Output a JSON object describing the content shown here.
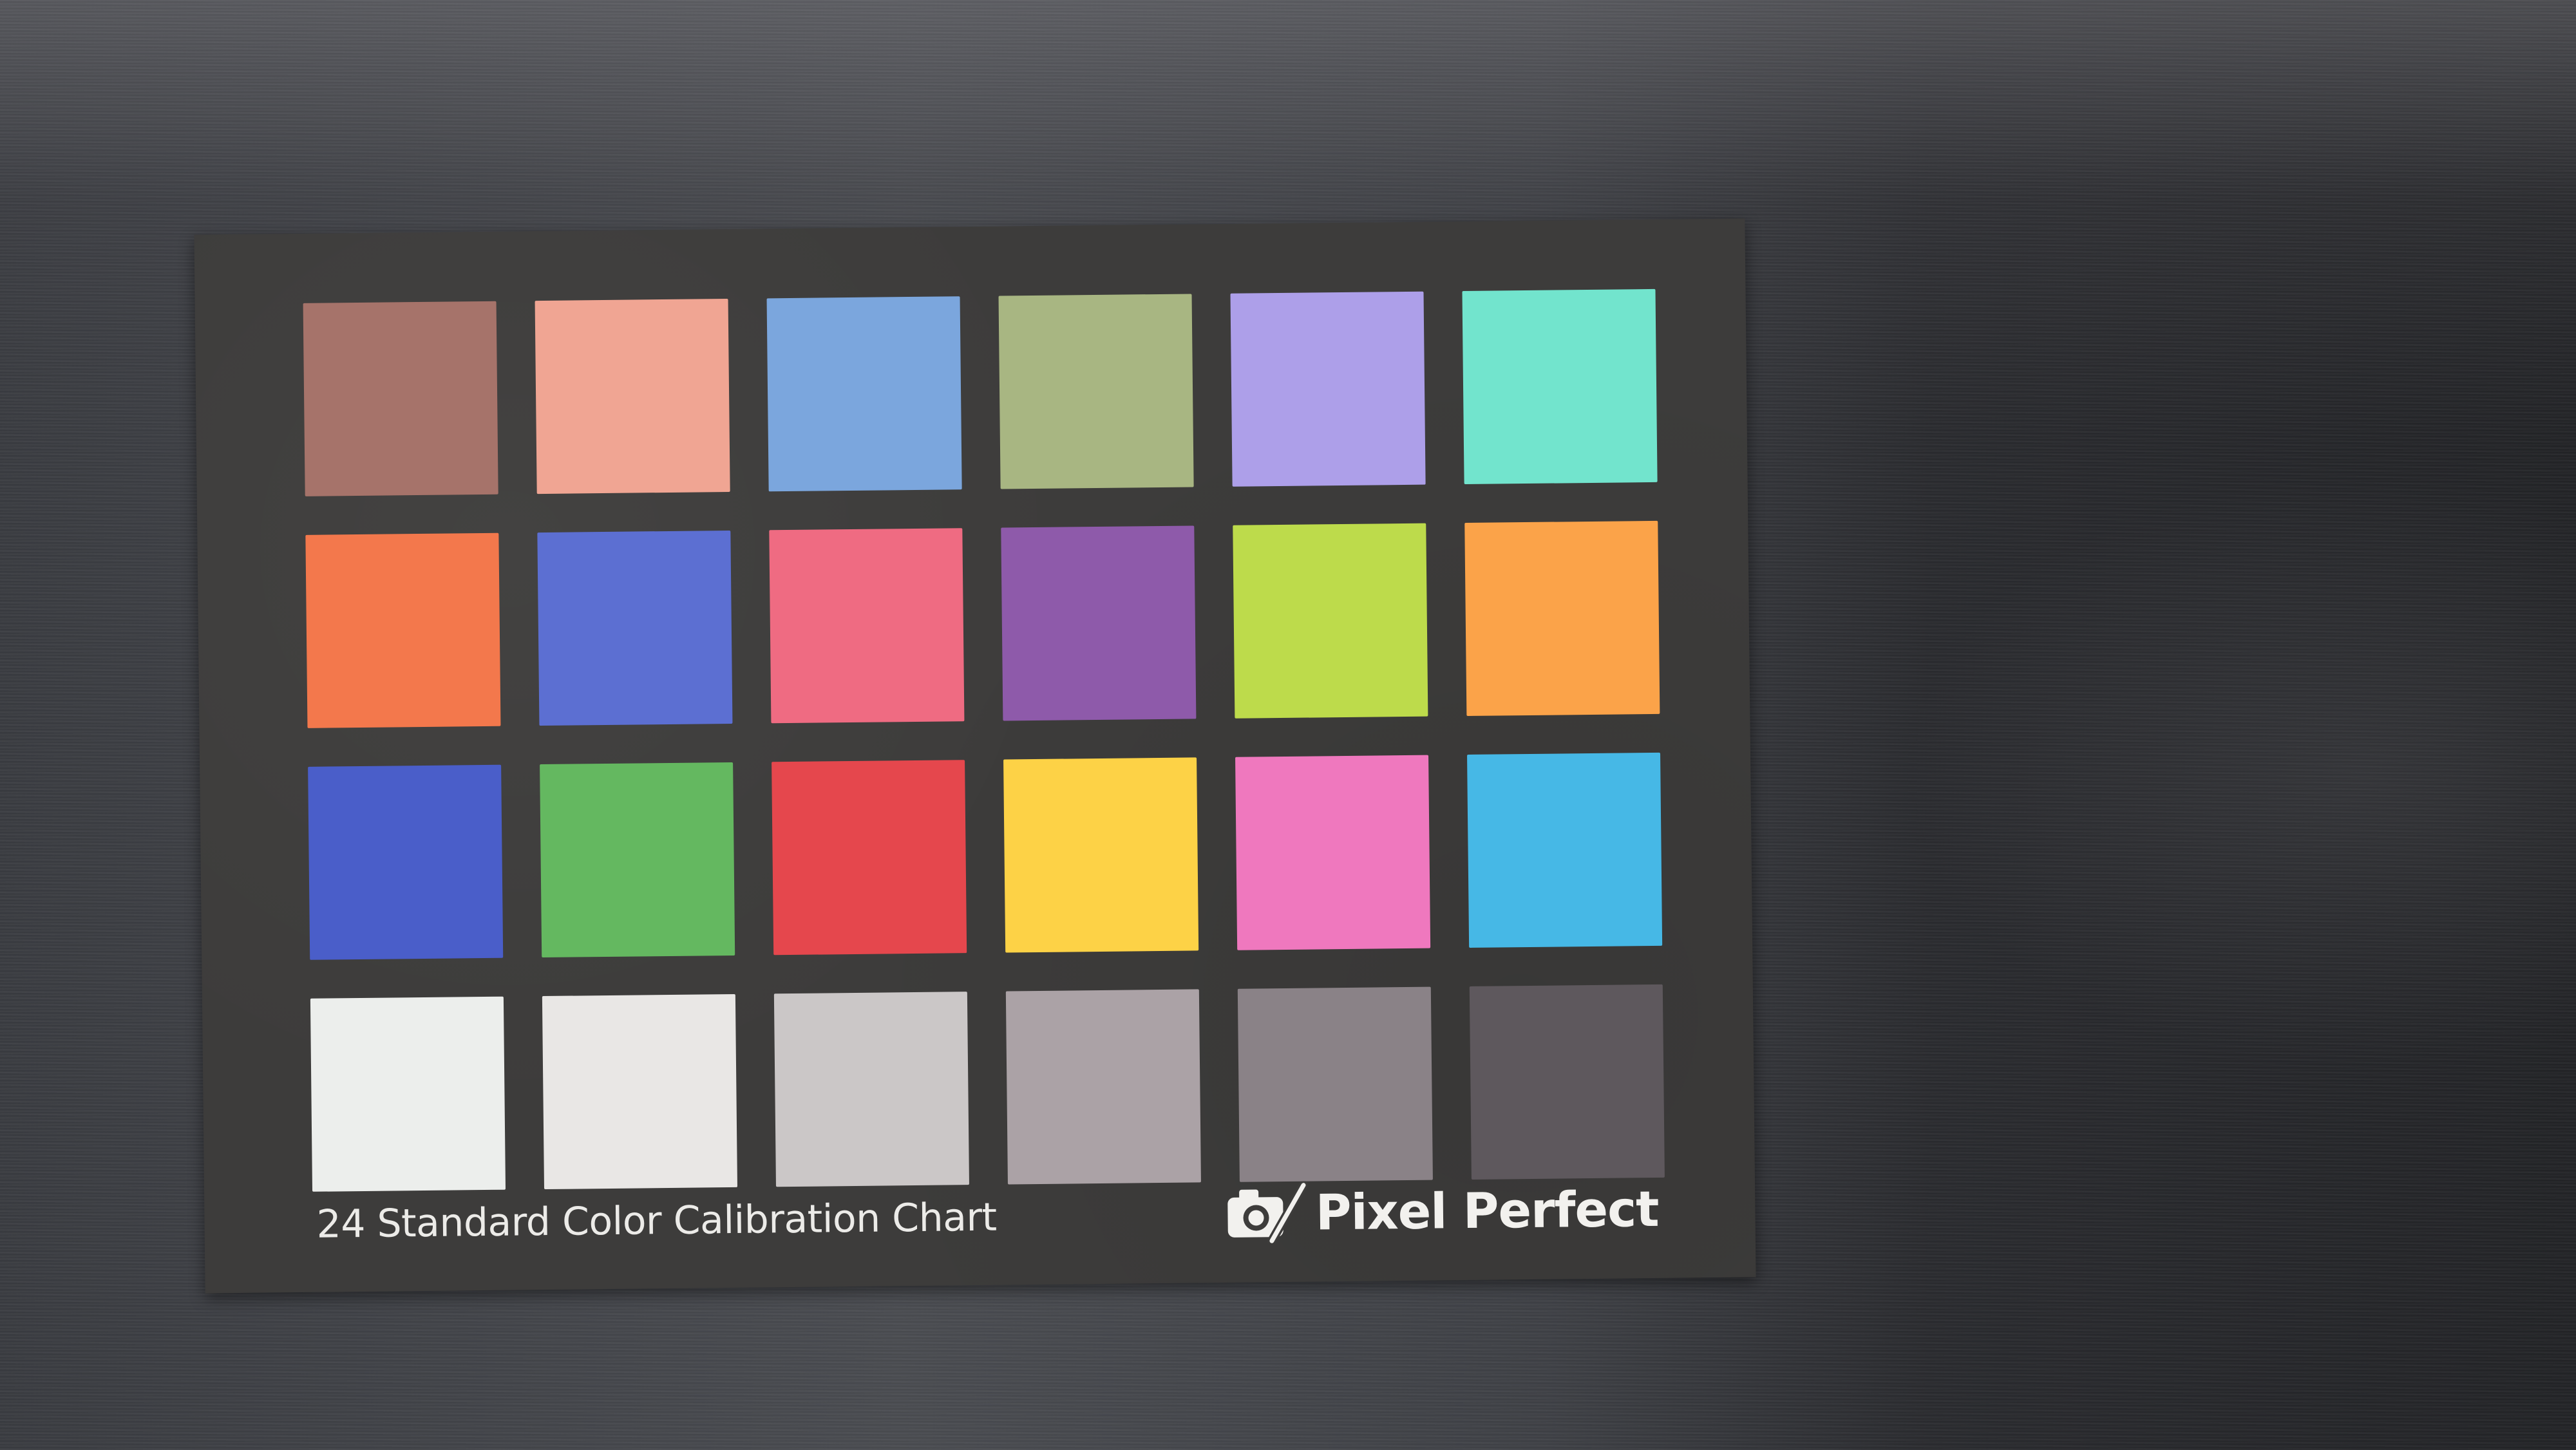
{
  "chart": {
    "caption": "24 Standard Color Calibration Chart",
    "brand": "Pixel Perfect",
    "brand_icon": "camera-slash-icon",
    "card_color": "#3d3c3b",
    "swatches": [
      [
        "#a6736a",
        "#f0a593",
        "#7ba6dd",
        "#a8b682",
        "#ad9fe9",
        "#72e4cd"
      ],
      [
        "#f3784c",
        "#5c6fd2",
        "#ef6b82",
        "#8e5aaa",
        "#bddb4b",
        "#fba349"
      ],
      [
        "#4a5ec9",
        "#64b860",
        "#e5474d",
        "#fdd246",
        "#ef78be",
        "#46b8e6"
      ],
      [
        "#eceeec",
        "#e9e7e5",
        "#cbc7c7",
        "#aba2a6",
        "#8a8287",
        "#5e585d"
      ]
    ]
  }
}
